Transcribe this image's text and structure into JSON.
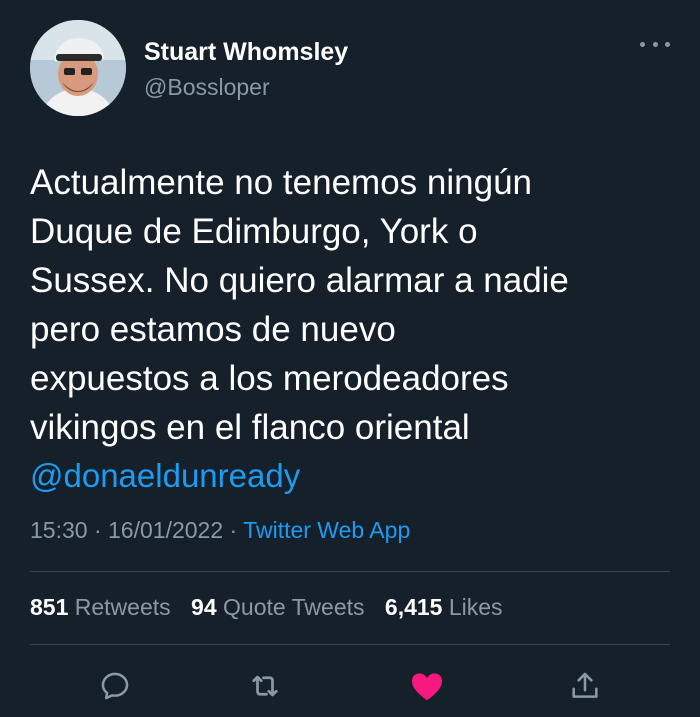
{
  "user": {
    "display_name": "Stuart Whomsley",
    "handle": "@Bossloper"
  },
  "tweet": {
    "lines": [
      "Actualmente no tenemos ningún",
      "Duque de Edimburgo, York o",
      "Sussex. No quiero alarmar a nadie",
      "pero estamos de nuevo",
      "expuestos a los merodeadores",
      "vikingos en el flanco oriental"
    ],
    "mention": "@donaeldunready",
    "time": "15:30",
    "date": "16/01/2022",
    "separator": "·",
    "source": "Twitter Web App"
  },
  "stats": {
    "retweets_count": "851",
    "retweets_label": "Retweets",
    "quotes_count": "94",
    "quotes_label": "Quote Tweets",
    "likes_count": "6,415",
    "likes_label": "Likes"
  },
  "actions": [
    {
      "icon": "reply-icon"
    },
    {
      "icon": "retweet-icon"
    },
    {
      "icon": "heart-icon",
      "liked": true
    },
    {
      "icon": "share-icon"
    }
  ],
  "colors": {
    "background": "#15202b",
    "text": "#ffffff",
    "secondary": "#8b98a5",
    "link": "#1d9bf0",
    "like": "#f91880",
    "divider": "#38444d"
  }
}
